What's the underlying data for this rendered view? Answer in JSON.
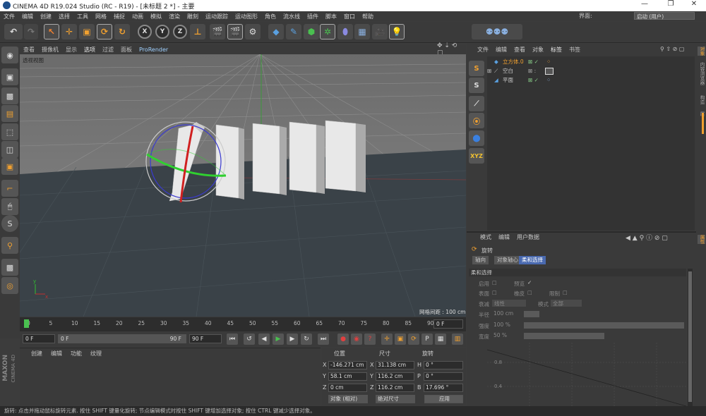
{
  "window": {
    "title": "CINEMA 4D R19.024 Studio (RC - R19) - [未标题 2 *] - 主要",
    "minimize": "—",
    "maximize": "❐",
    "close": "✕"
  },
  "menubar": [
    "文件",
    "编辑",
    "创建",
    "选择",
    "工具",
    "网格",
    "捕捉",
    "动画",
    "模拟",
    "渲染",
    "雕刻",
    "运动跟踪",
    "运动图形",
    "角色",
    "流水线",
    "插件",
    "脚本",
    "窗口",
    "帮助"
  ],
  "layout": {
    "label": "界面:",
    "value": "启动 (用户)"
  },
  "viewport": {
    "menu": [
      "查看",
      "摄像机",
      "显示",
      "选项",
      "过滤",
      "面板",
      "ProRender"
    ],
    "name": "透视视图",
    "grid_spacing": "网格间距 : 100 cm"
  },
  "timeline": {
    "ticks": [
      "0",
      "5",
      "10",
      "15",
      "20",
      "25",
      "30",
      "35",
      "40",
      "45",
      "50",
      "55",
      "60",
      "65",
      "70",
      "75",
      "80",
      "85",
      "90"
    ],
    "current_frame": "0 F"
  },
  "transport": {
    "start": "0 F",
    "range_start": "0 F",
    "range_end": "90 F",
    "end": "90 F"
  },
  "material": {
    "menu": [
      "创建",
      "编辑",
      "功能",
      "纹理"
    ]
  },
  "coords": {
    "headers": [
      "位置",
      "尺寸",
      "旋转"
    ],
    "rows": [
      {
        "axis": "X",
        "pos": "-146.271 cm",
        "saxis": "X",
        "size": "31.138 cm",
        "raxis": "H",
        "rot": "0 °"
      },
      {
        "axis": "Y",
        "pos": "58.1 cm",
        "saxis": "Y",
        "size": "116.2 cm",
        "raxis": "P",
        "rot": "0 °"
      },
      {
        "axis": "Z",
        "pos": "0 cm",
        "saxis": "Z",
        "size": "116.2 cm",
        "raxis": "B",
        "rot": "17.696 °"
      }
    ],
    "mode": "对象 (相对)",
    "size_mode": "绝对尺寸",
    "apply": "应用"
  },
  "objects": {
    "menu": [
      "文件",
      "编辑",
      "查看",
      "对象",
      "标签",
      "书签"
    ],
    "items": [
      {
        "name": "立方体.0",
        "color": "#f0a030"
      },
      {
        "name": "空白",
        "color": "#cccccc"
      },
      {
        "name": "平面",
        "color": "#cccccc"
      }
    ]
  },
  "attributes": {
    "menu": [
      "模式",
      "编辑",
      "用户数据"
    ],
    "object": "旋转",
    "tabs": [
      "轴向",
      "对象轴心",
      "柔和选择"
    ],
    "section": "柔和选择",
    "enable": "启用",
    "preview": "预览",
    "surface": "表面",
    "rubber": "橡皮",
    "restrict": "限制",
    "mode_label": "衰减",
    "mode_value": "线性",
    "mode2_label": "模式",
    "mode2_value": "全部",
    "radius_label": "半径",
    "radius": "100 cm",
    "strength_label": "强度",
    "strength": "100 %",
    "width_label": "宽度",
    "width": "50 %",
    "graph_ticks": [
      "0.8",
      "0.4"
    ]
  },
  "status": "旋转: 点击并拖动鼠标旋转元素. 按住 SHIFT 键量化旋转; 节点编辑模式时按住 SHIFT 键增加选择对象; 按住 CTRL 键减少选择对象。",
  "maxon": {
    "brand": "MAXON",
    "product": "CINEMA 4D"
  },
  "right_tabs": [
    "对象",
    "内容浏览器",
    "构造",
    "层"
  ],
  "attr_right_tab": "属性"
}
